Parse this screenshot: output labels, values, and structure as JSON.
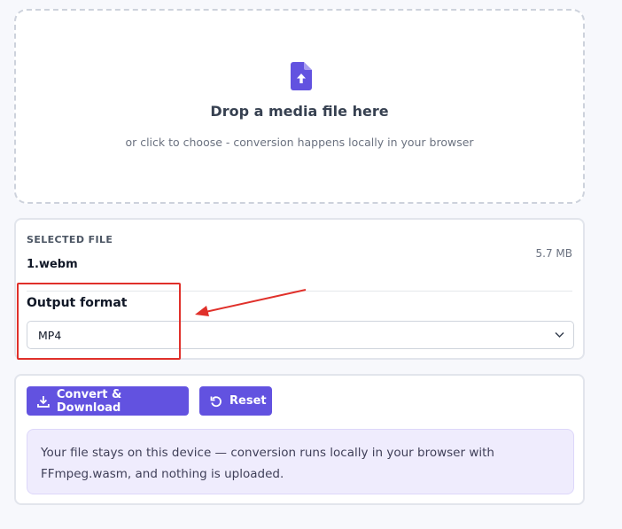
{
  "dropzone": {
    "icon": "file-upload-icon",
    "title": "Drop a media file here",
    "subtitle": "or click to choose - conversion happens locally in your browser"
  },
  "file": {
    "section_label": "SELECTED FILE",
    "name": "1.webm",
    "size": "5.7 MB"
  },
  "output": {
    "label": "Output format",
    "selected": "MP4"
  },
  "actions": {
    "convert_label": "Convert & Download",
    "reset_label": "Reset"
  },
  "notice": {
    "line1": "Your file stays on this device — conversion runs locally in your browser with",
    "line2": "FFmpeg.wasm, and nothing is uploaded."
  },
  "colors": {
    "accent": "#6252e0",
    "annotation": "#e0302a",
    "notice_bg": "#efecfd"
  }
}
